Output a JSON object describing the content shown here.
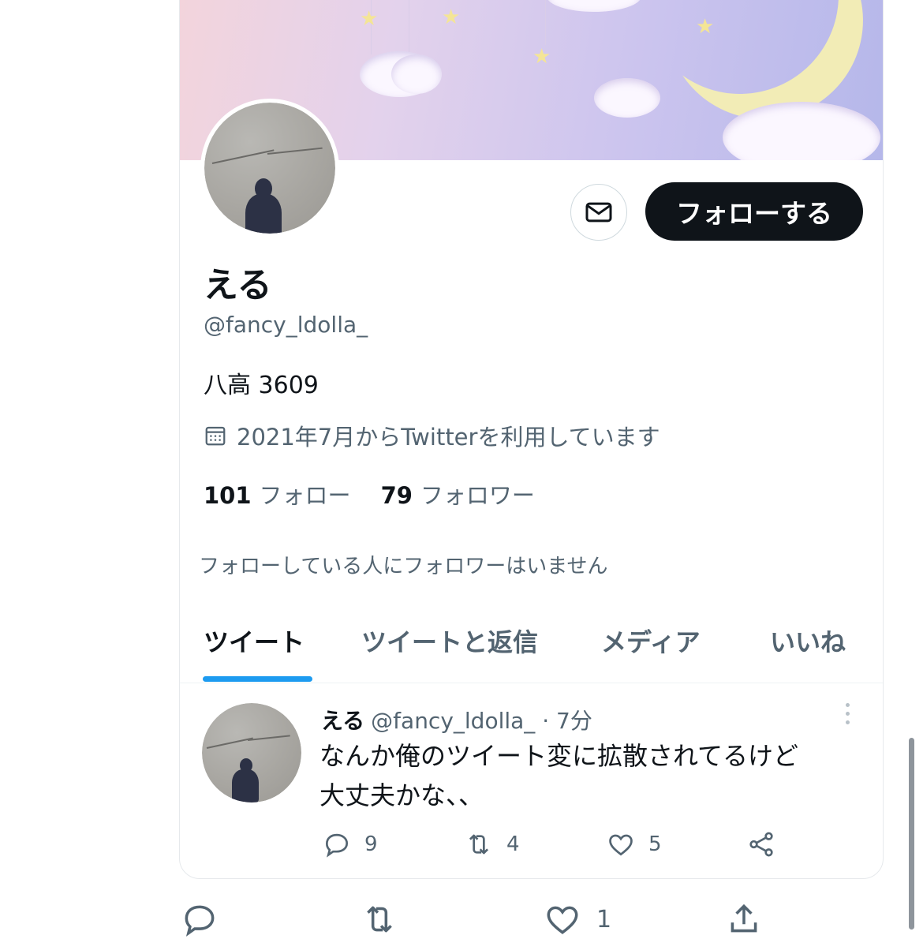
{
  "profile": {
    "display_name": "える",
    "handle": "@fancy_ldolla_",
    "bio": "八高 3609",
    "joined": "2021年7月からTwitterを利用しています",
    "following_count": "101",
    "following_label": "フォロー",
    "followers_count": "79",
    "followers_label": "フォロワー",
    "mutual_notice": "フォローしている人にフォロワーはいません"
  },
  "buttons": {
    "follow_label": "フォローする"
  },
  "tabs": [
    {
      "label": "ツイート",
      "active": true
    },
    {
      "label": "ツイートと返信",
      "active": false
    },
    {
      "label": "メディア",
      "active": false
    },
    {
      "label": "いいね",
      "active": false
    }
  ],
  "tweet": {
    "name": "える",
    "handle_time": "@fancy_ldolla_ · 7分",
    "text_line1": "なんか俺のツイート変に拡散されてるけど",
    "text_line2": "大丈夫かな、、",
    "replies": "9",
    "retweets": "4",
    "likes": "5"
  },
  "outer_actions": {
    "likes": "1"
  },
  "colors": {
    "accent": "#1d9bf0",
    "text": "#0f1419",
    "secondary": "#536471",
    "follow_button": "#0f1419"
  },
  "icons": [
    "mail-icon",
    "calendar-icon",
    "reply-icon",
    "retweet-icon",
    "like-icon",
    "share-icon",
    "more-icon"
  ]
}
